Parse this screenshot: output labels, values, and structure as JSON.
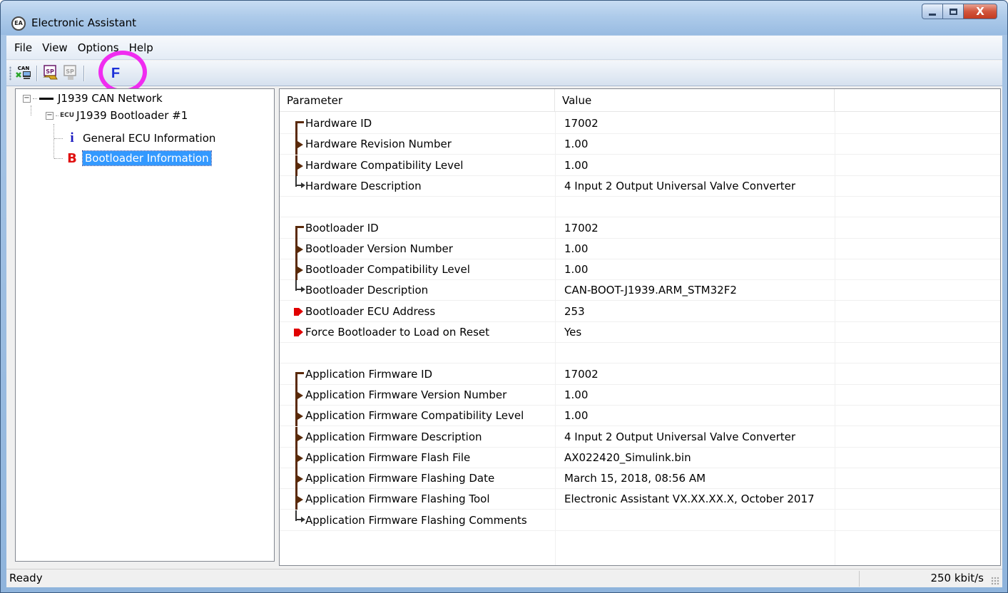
{
  "window": {
    "title": "Electronic Assistant",
    "icon_text": "EA",
    "close_symbol": "X"
  },
  "menu": {
    "items": [
      "File",
      "View",
      "Options",
      "Help"
    ]
  },
  "toolbar": {
    "buttons": [
      {
        "name": "can-connect",
        "icon": "can-network-icon",
        "label": "CAN"
      },
      {
        "name": "sp-save",
        "icon": "setpoint-save-icon",
        "label": "SP"
      },
      {
        "name": "sp-load",
        "icon": "setpoint-load-icon",
        "label": "SP"
      },
      {
        "name": "flash",
        "icon": "flash-icon",
        "label": "F"
      }
    ],
    "highlight_color": "#f02cf0"
  },
  "tree": {
    "network_label": "J1939 CAN Network",
    "ecu_prefix": "ECU",
    "ecu_label": "J1939 Bootloader #1",
    "items": [
      {
        "icon": "i",
        "label": "General ECU Information",
        "selected": false
      },
      {
        "icon": "B",
        "label": "Bootloader Information",
        "selected": true
      }
    ]
  },
  "list": {
    "columns": [
      "Parameter",
      "Value"
    ],
    "rows": [
      {
        "type": "start",
        "param": "Hardware ID",
        "value": "17002"
      },
      {
        "type": "mid",
        "param": "Hardware Revision Number",
        "value": "1.00"
      },
      {
        "type": "mid",
        "param": "Hardware Compatibility Level",
        "value": "1.00"
      },
      {
        "type": "end",
        "param": "Hardware Description",
        "value": "4 Input 2 Output Universal Valve Converter"
      },
      {
        "type": "blank",
        "param": "",
        "value": ""
      },
      {
        "type": "start",
        "param": "Bootloader ID",
        "value": "17002"
      },
      {
        "type": "mid",
        "param": "Bootloader Version Number",
        "value": "1.00"
      },
      {
        "type": "mid",
        "param": "Bootloader Compatibility Level",
        "value": "1.00"
      },
      {
        "type": "end",
        "param": "Bootloader Description",
        "value": "CAN-BOOT-J1939.ARM_STM32F2"
      },
      {
        "type": "edit",
        "param": "Bootloader ECU Address",
        "value": "253"
      },
      {
        "type": "edit",
        "param": "Force Bootloader to Load on Reset",
        "value": "Yes"
      },
      {
        "type": "blank",
        "param": "",
        "value": ""
      },
      {
        "type": "start",
        "param": "Application Firmware ID",
        "value": "17002"
      },
      {
        "type": "mid",
        "param": "Application Firmware Version Number",
        "value": "1.00"
      },
      {
        "type": "mid",
        "param": "Application Firmware Compatibility Level",
        "value": "1.00"
      },
      {
        "type": "mid",
        "param": "Application Firmware Description",
        "value": "4 Input 2 Output Universal Valve Converter"
      },
      {
        "type": "mid",
        "param": "Application Firmware Flash File",
        "value": "AX022420_Simulink.bin"
      },
      {
        "type": "mid",
        "param": "Application Firmware Flashing Date",
        "value": "March 15, 2018, 08:56 AM"
      },
      {
        "type": "mid",
        "param": "Application Firmware Flashing Tool",
        "value": "Electronic Assistant VX.XX.XX.X, October 2017"
      },
      {
        "type": "end",
        "param": "Application Firmware Flashing Comments",
        "value": ""
      }
    ]
  },
  "status": {
    "left": "Ready",
    "right": "250 kbit/s"
  }
}
